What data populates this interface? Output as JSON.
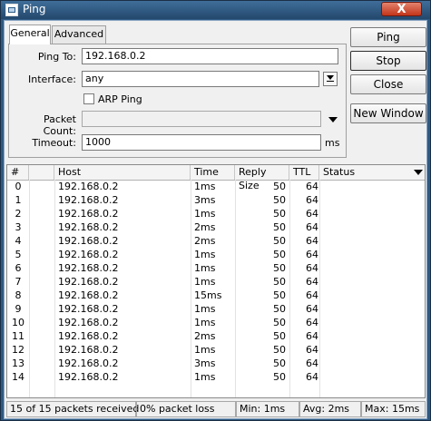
{
  "window": {
    "title": "Ping",
    "close_label": "X"
  },
  "tabs": [
    {
      "label": "General"
    },
    {
      "label": "Advanced"
    }
  ],
  "form": {
    "ping_to": {
      "label": "Ping To:",
      "value": "192.168.0.2"
    },
    "interface": {
      "label": "Interface:",
      "value": "any"
    },
    "arp_ping": {
      "label": "ARP Ping",
      "checked": false
    },
    "packet_count": {
      "label": "Packet Count:",
      "value": ""
    },
    "timeout": {
      "label": "Timeout:",
      "value": "1000",
      "unit": "ms"
    }
  },
  "buttons": {
    "ping": "Ping",
    "stop": "Stop",
    "close": "Close",
    "new_window": "New Window"
  },
  "table": {
    "columns": [
      "#",
      "",
      "Host",
      "Time",
      "Reply Size",
      "TTL",
      "Status"
    ],
    "rows": [
      {
        "n": "0",
        "host": "192.168.0.2",
        "time": "1ms",
        "size": "50",
        "ttl": "64",
        "status": ""
      },
      {
        "n": "1",
        "host": "192.168.0.2",
        "time": "3ms",
        "size": "50",
        "ttl": "64",
        "status": ""
      },
      {
        "n": "2",
        "host": "192.168.0.2",
        "time": "1ms",
        "size": "50",
        "ttl": "64",
        "status": ""
      },
      {
        "n": "3",
        "host": "192.168.0.2",
        "time": "2ms",
        "size": "50",
        "ttl": "64",
        "status": ""
      },
      {
        "n": "4",
        "host": "192.168.0.2",
        "time": "2ms",
        "size": "50",
        "ttl": "64",
        "status": ""
      },
      {
        "n": "5",
        "host": "192.168.0.2",
        "time": "1ms",
        "size": "50",
        "ttl": "64",
        "status": ""
      },
      {
        "n": "6",
        "host": "192.168.0.2",
        "time": "1ms",
        "size": "50",
        "ttl": "64",
        "status": ""
      },
      {
        "n": "7",
        "host": "192.168.0.2",
        "time": "1ms",
        "size": "50",
        "ttl": "64",
        "status": ""
      },
      {
        "n": "8",
        "host": "192.168.0.2",
        "time": "15ms",
        "size": "50",
        "ttl": "64",
        "status": ""
      },
      {
        "n": "9",
        "host": "192.168.0.2",
        "time": "1ms",
        "size": "50",
        "ttl": "64",
        "status": ""
      },
      {
        "n": "10",
        "host": "192.168.0.2",
        "time": "1ms",
        "size": "50",
        "ttl": "64",
        "status": ""
      },
      {
        "n": "11",
        "host": "192.168.0.2",
        "time": "2ms",
        "size": "50",
        "ttl": "64",
        "status": ""
      },
      {
        "n": "12",
        "host": "192.168.0.2",
        "time": "1ms",
        "size": "50",
        "ttl": "64",
        "status": ""
      },
      {
        "n": "13",
        "host": "192.168.0.2",
        "time": "3ms",
        "size": "50",
        "ttl": "64",
        "status": ""
      },
      {
        "n": "14",
        "host": "192.168.0.2",
        "time": "1ms",
        "size": "50",
        "ttl": "64",
        "status": ""
      }
    ]
  },
  "status": {
    "received": "15 of 15 packets received",
    "loss": "0% packet loss",
    "min": "Min: 1ms",
    "avg": "Avg: 2ms",
    "max": "Max: 15ms"
  }
}
